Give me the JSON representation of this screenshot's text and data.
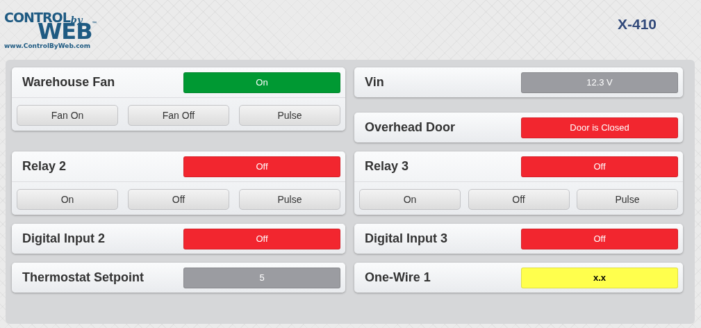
{
  "logo": {
    "word_1": "CONTROL",
    "word_2": "by",
    "word_3": "WEB",
    "trademark": "™",
    "url": "www.ControlByWeb.com"
  },
  "device": {
    "title": "X-410"
  },
  "sections": [
    {
      "left": [
        {
          "label": "Warehouse Fan",
          "status": {
            "text": "On",
            "color": "#009933"
          },
          "buttons": [
            "Fan On",
            "Fan Off",
            "Pulse"
          ]
        }
      ],
      "right": [
        {
          "label": "Vin",
          "status": {
            "text": "12.3 V",
            "color": "#9b9ca1"
          }
        },
        {
          "label": "Overhead Door",
          "status": {
            "text": "Door is Closed",
            "color": "#f2262f"
          }
        }
      ]
    },
    {
      "left": [
        {
          "label": "Relay 2",
          "status": {
            "text": "Off",
            "color": "#f2262f"
          },
          "buttons": [
            "On",
            "Off",
            "Pulse"
          ]
        }
      ],
      "right": [
        {
          "label": "Relay 3",
          "status": {
            "text": "Off",
            "color": "#f2262f"
          },
          "buttons": [
            "On",
            "Off",
            "Pulse"
          ]
        }
      ]
    },
    {
      "left": [
        {
          "label": "Digital Input 2",
          "status": {
            "text": "Off",
            "color": "#f2262f"
          }
        }
      ],
      "right": [
        {
          "label": "Digital Input 3",
          "status": {
            "text": "Off",
            "color": "#f2262f"
          }
        }
      ]
    },
    {
      "left": [
        {
          "label": "Thermostat Setpoint",
          "status": {
            "text": "5",
            "color": "#9b9ca1"
          }
        }
      ],
      "right": [
        {
          "label": "One-Wire 1",
          "status": {
            "text": "x.x",
            "color": "#ffff4d"
          }
        }
      ]
    }
  ]
}
